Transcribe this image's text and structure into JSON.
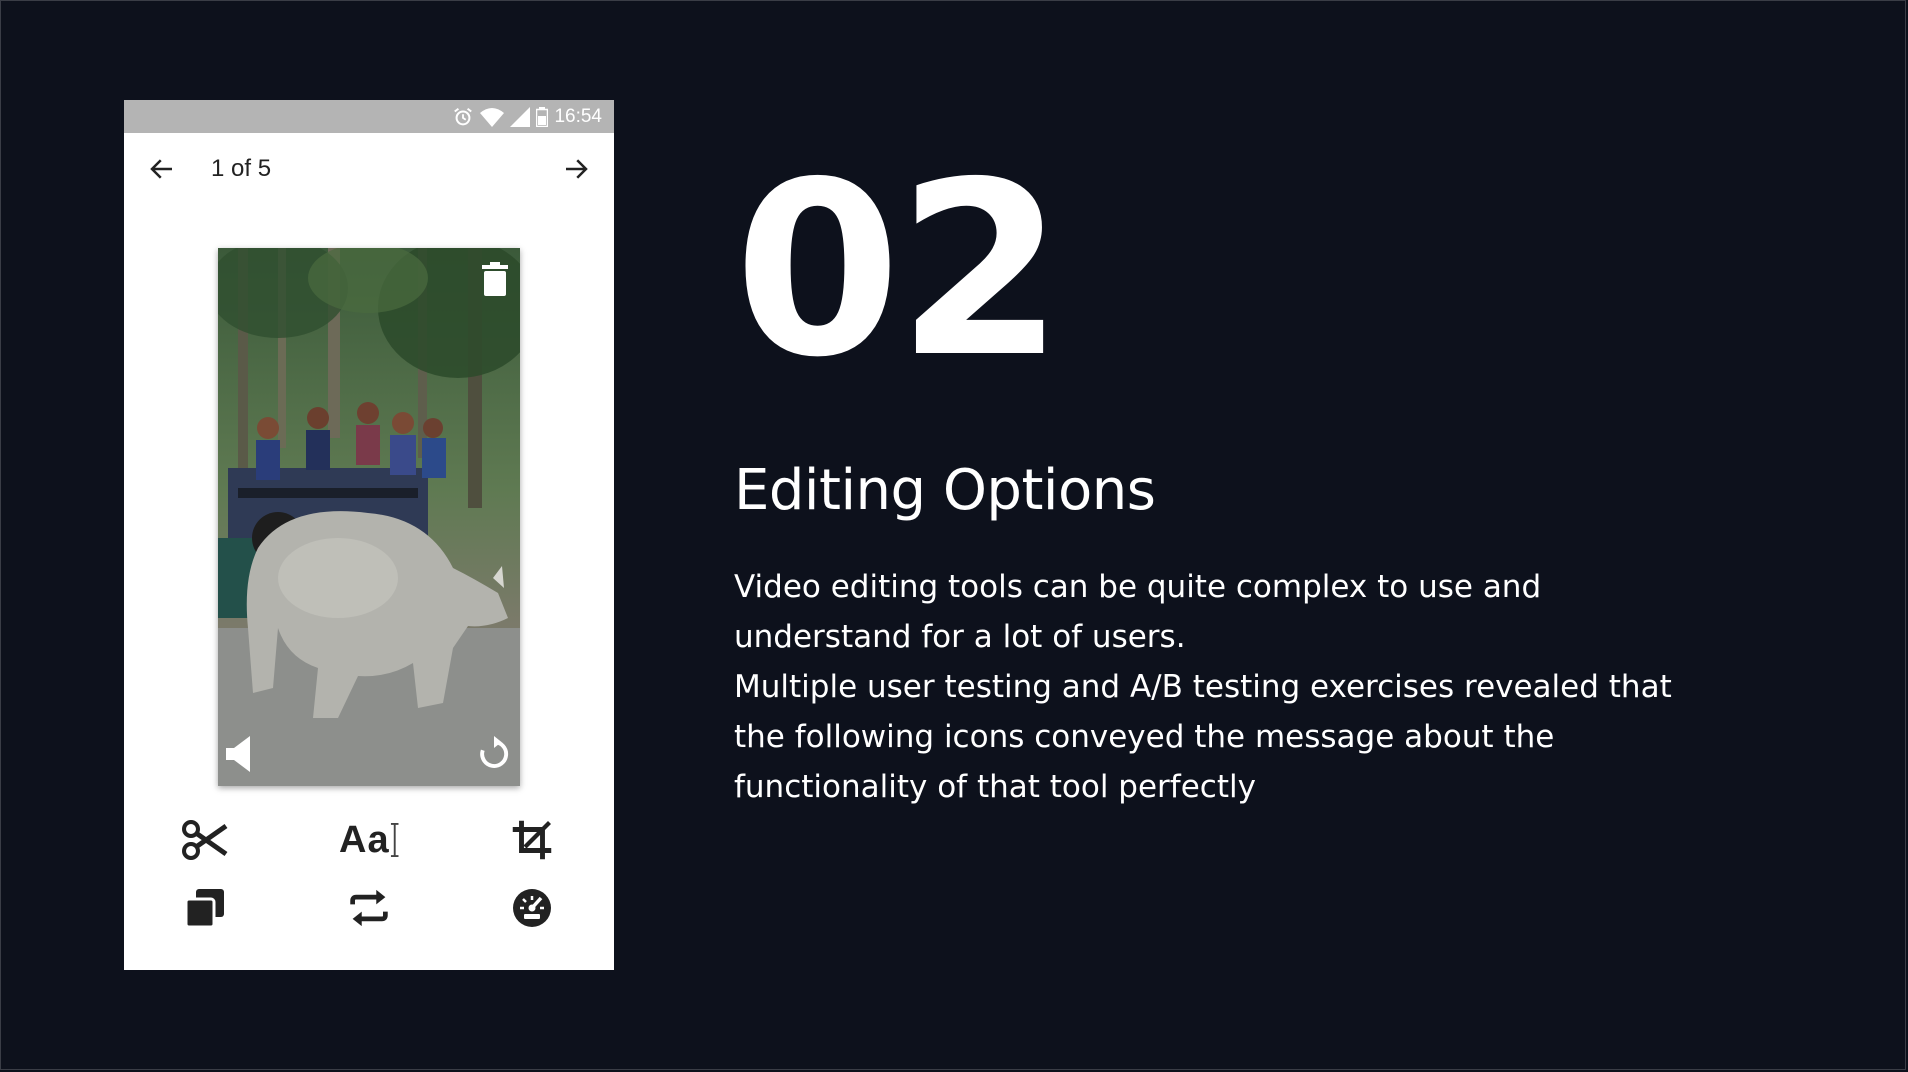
{
  "phone": {
    "status_bar": {
      "time": "16:54",
      "icons": [
        "alarm-icon",
        "wifi-icon",
        "cell-signal-icon",
        "battery-icon"
      ]
    },
    "app_bar": {
      "back_icon": "arrow-left-icon",
      "counter": "1 of 5",
      "forward_icon": "arrow-right-icon"
    },
    "media": {
      "overlay_icons": [
        "trash-icon",
        "volume-icon",
        "replay-icon"
      ]
    },
    "tools": {
      "row1": [
        "scissors-icon",
        "text-icon",
        "crop-icon"
      ],
      "row2": [
        "copy-icon",
        "loop-icon",
        "speedometer-icon"
      ],
      "text_tool_label": "Aa"
    }
  },
  "slide": {
    "number": "02",
    "title": "Editing Options",
    "paragraph1_line1": "Video editing tools can be quite complex to use and",
    "paragraph1_line2": "understand for a lot of users.",
    "paragraph2_line1": "Multiple user testing and A/B testing exercises revealed that",
    "paragraph2_line2": "the following icons conveyed the message about the",
    "paragraph2_line3": "functionality of that tool perfectly"
  },
  "colors": {
    "background": "#0d111c",
    "text": "#ffffff",
    "status_bar": "#b4b4b4",
    "icon": "#222222"
  }
}
